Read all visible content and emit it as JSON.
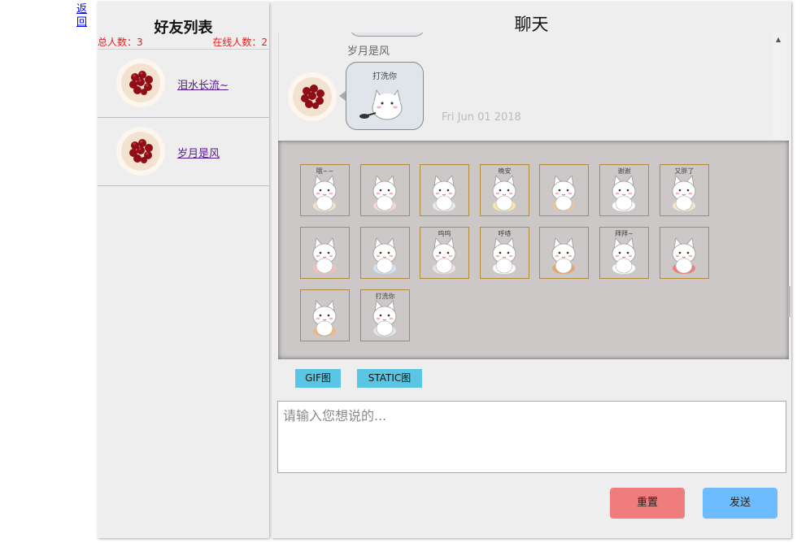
{
  "nav": {
    "back_label": "返回"
  },
  "friends": {
    "title": "好友列表",
    "total_count": "总人数：3",
    "online_count": "在线人数：2",
    "items": [
      {
        "name": "泪水长流~"
      },
      {
        "name": "岁月是风"
      }
    ]
  },
  "chat": {
    "title": "聊天",
    "message": {
      "sender": "岁月是风",
      "sticker_text": "打洗你",
      "time": "Fri Jun 01 2018"
    },
    "emoji_captions": [
      "哦~~",
      "",
      "",
      "晚安",
      "",
      "谢谢",
      "又胖了",
      "",
      "",
      "呜呜",
      "呼哧",
      "",
      "拜拜~",
      "",
      "",
      "打洗你"
    ],
    "tabs": {
      "gif": "GIF图",
      "static": "STATIC图"
    },
    "input": {
      "placeholder": "请输入您想说的...",
      "value": ""
    },
    "buttons": {
      "reset": "重置",
      "send": "发送"
    }
  },
  "colors": {
    "panel_bg": "#eeeeee",
    "emoji_panel_bg": "#cdc8c8",
    "count_text": "#e02020",
    "tab_bg": "#5bc6e3",
    "reset_bg": "#f07d7d",
    "send_bg": "#6cbcff"
  },
  "icons": {
    "friend_avatar": "cherry-bowl-icon",
    "sticker": "white-cat-sticker-icon",
    "scroll_up": "triangle-up-icon"
  }
}
